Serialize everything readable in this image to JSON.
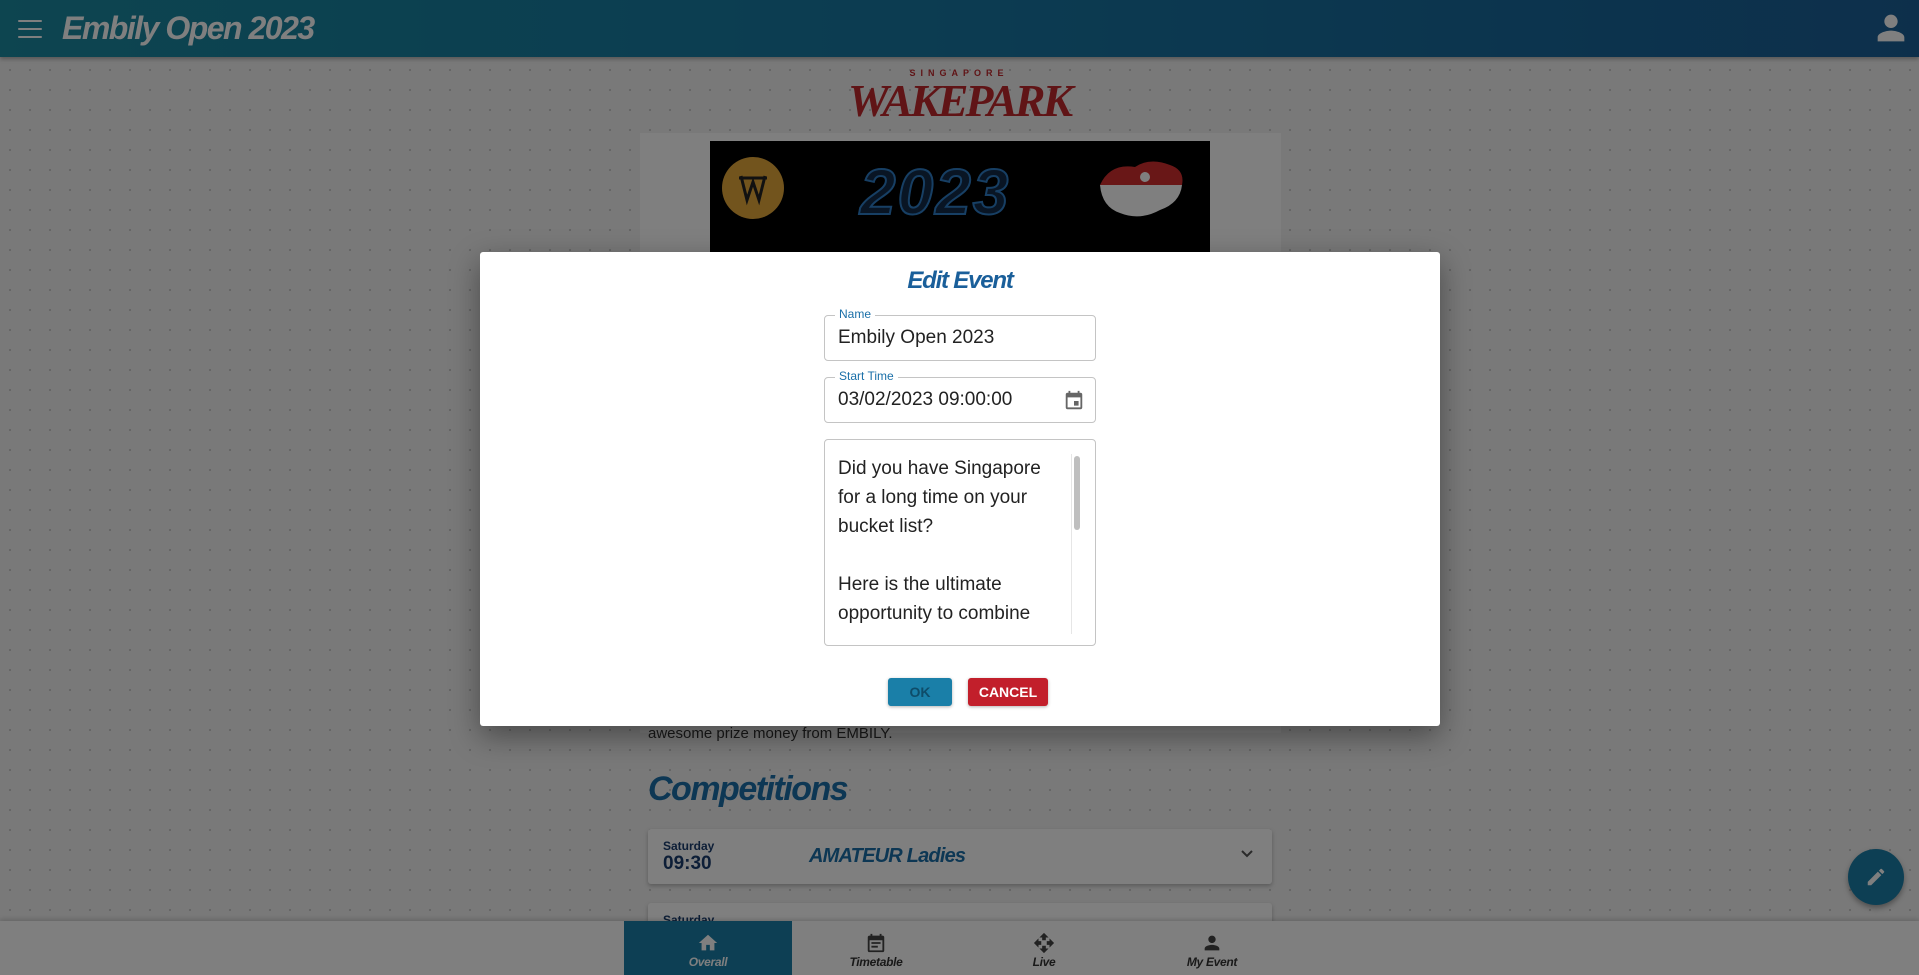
{
  "app": {
    "title": "Embily Open 2023"
  },
  "logo": {
    "small_text": "SINGAPORE",
    "big_text": "WAKEPARK"
  },
  "banner": {
    "year": "2023"
  },
  "page": {
    "body_text_fragment": "awesome prize money from EMBILY.",
    "competitions_heading": "Competitions",
    "competitions": [
      {
        "day": "Saturday",
        "time": "09:30",
        "name": "AMATEUR Ladies"
      },
      {
        "day": "Saturday",
        "time": "",
        "name": ""
      }
    ]
  },
  "bottom_nav": [
    {
      "label": "Overall",
      "icon": "home-icon",
      "active": true
    },
    {
      "label": "Timetable",
      "icon": "calendar-icon",
      "active": false
    },
    {
      "label": "Live",
      "icon": "move-arrows-icon",
      "active": false
    },
    {
      "label": "My Event",
      "icon": "person-icon",
      "active": false
    }
  ],
  "dialog": {
    "title": "Edit Event",
    "name_label": "Name",
    "name_value": "Embily Open 2023",
    "start_time_label": "Start Time",
    "start_time_value": "03/02/2023 09:00:00",
    "description_value": "Did you have Singapore for a long time on your bucket list?\n\nHere is the ultimate opportunity to combine",
    "ok_label": "OK",
    "cancel_label": "CANCEL"
  },
  "colors": {
    "primary": "#1a7fa8",
    "danger": "#c21f2b",
    "title_blue": "#1a5f9a"
  }
}
